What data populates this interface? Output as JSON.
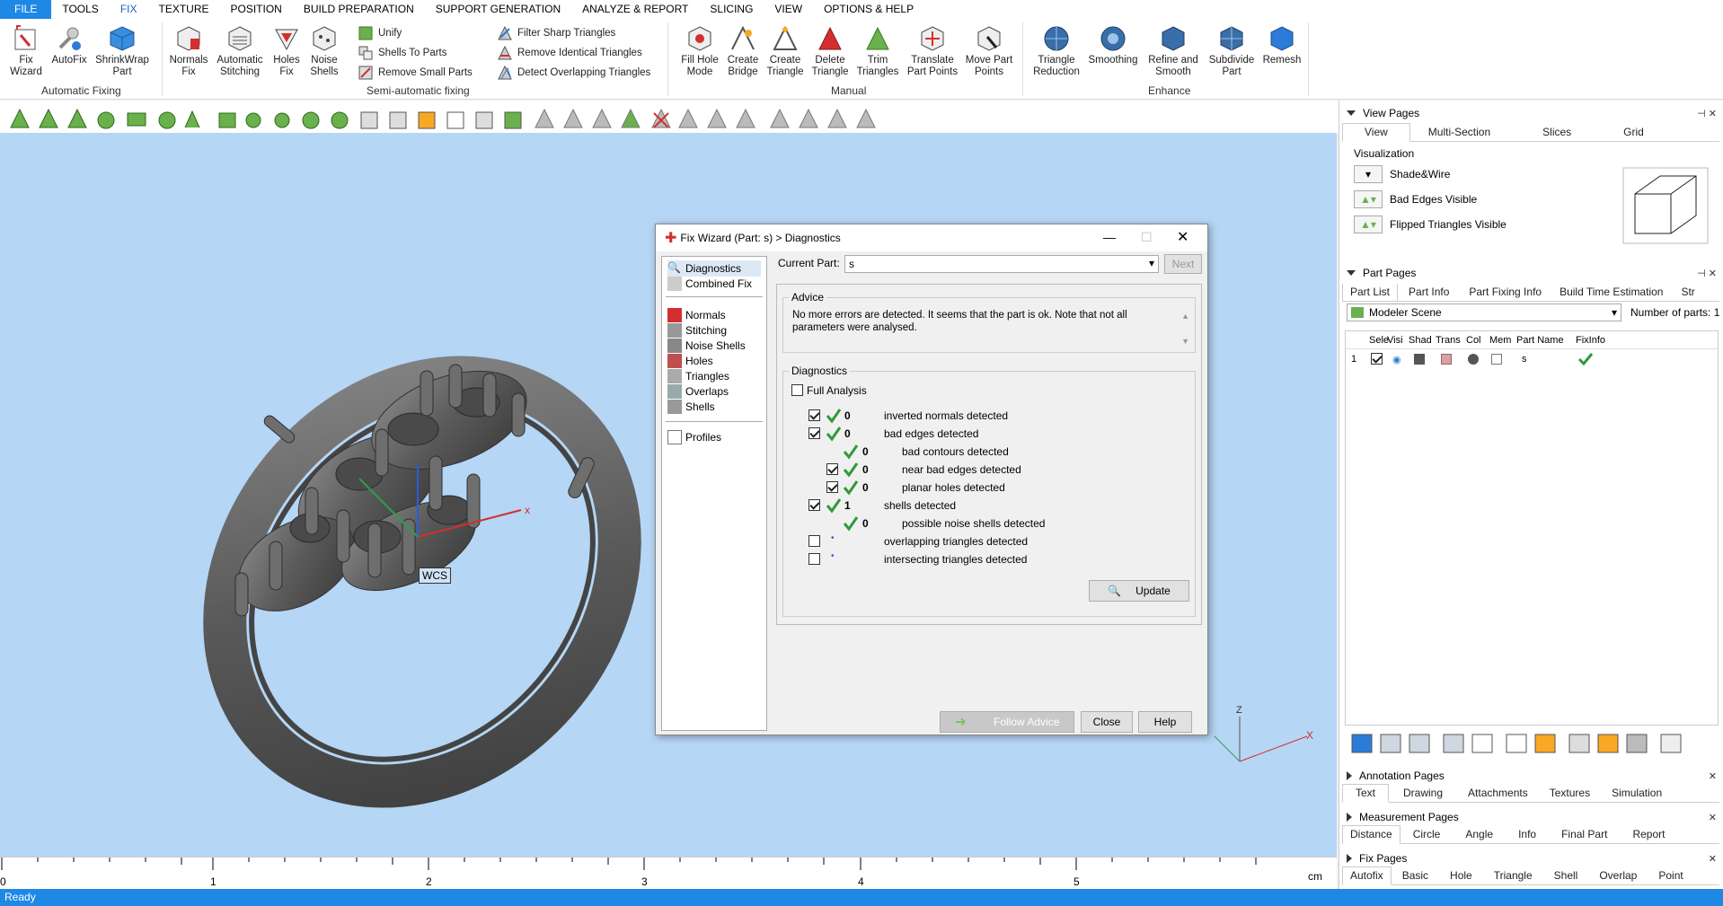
{
  "menu": [
    "FILE",
    "TOOLS",
    "FIX",
    "TEXTURE",
    "POSITION",
    "BUILD PREPARATION",
    "SUPPORT GENERATION",
    "ANALYZE & REPORT",
    "SLICING",
    "VIEW",
    "OPTIONS & HELP"
  ],
  "ribbon": {
    "auto": [
      "Fix\nWizard",
      "AutoFix",
      "ShrinkWrap\nPart"
    ],
    "auto_group": "Automatic Fixing",
    "semi_big": [
      "Normals\nFix",
      "Automatic\nStitching",
      "Holes\nFix",
      "Noise\nShells"
    ],
    "semi_small": [
      "Unify",
      "Shells To Parts",
      "Remove Small Parts"
    ],
    "semi_group": "Semi-automatic fixing",
    "filters": [
      "Filter Sharp Triangles",
      "Remove Identical Triangles",
      "Detect Overlapping Triangles"
    ],
    "manual": [
      "Fill Hole\nMode",
      "Create\nBridge",
      "Create\nTriangle",
      "Delete\nTriangle",
      "Trim\nTriangles",
      "Translate\nPart Points",
      "Move Part\nPoints"
    ],
    "manual_group": "Manual",
    "enhance": [
      "Triangle\nReduction",
      "Smoothing",
      "Refine and\nSmooth",
      "Subdivide\nPart",
      "Remesh"
    ],
    "enhance_group": "Enhance"
  },
  "viewport": {
    "wcs": "WCS",
    "x": "x",
    "z": "Z",
    "x2": "X"
  },
  "ruler": {
    "labels": [
      "0",
      "1",
      "2",
      "3",
      "4",
      "5"
    ],
    "unit": "cm"
  },
  "status": "Ready",
  "dialog": {
    "title": "Fix Wizard (Part: s) > Diagnostics",
    "nav_top": [
      "Diagnostics",
      "Combined Fix"
    ],
    "nav_mid": [
      "Normals",
      "Stitching",
      "Noise Shells",
      "Holes",
      "Triangles",
      "Overlaps",
      "Shells"
    ],
    "nav_bottom": [
      "Profiles"
    ],
    "current_part_label": "Current Part:",
    "current_part_value": "s",
    "next": "Next",
    "advice_label": "Advice",
    "advice_text": "No more errors are detected. It seems that the part is ok. Note that not all parameters were analysed.",
    "diag_label": "Diagnostics",
    "full_analysis": "Full Analysis",
    "rows": [
      {
        "count": "0",
        "text": "inverted normals detected"
      },
      {
        "count": "0",
        "text": "bad edges detected"
      },
      {
        "count": "0",
        "text": "bad contours detected"
      },
      {
        "count": "0",
        "text": "near bad edges detected"
      },
      {
        "count": "0",
        "text": "planar holes detected"
      },
      {
        "count": "1",
        "text": "shells detected"
      },
      {
        "count": "0",
        "text": "possible noise shells detected"
      },
      {
        "count": "",
        "text": "overlapping triangles detected"
      },
      {
        "count": "",
        "text": "intersecting triangles detected"
      }
    ],
    "update": "Update",
    "follow": "Follow Advice",
    "close": "Close",
    "help": "Help"
  },
  "right": {
    "view_pages": "View Pages",
    "view_tabs": [
      "View",
      "Multi-Section",
      "Slices",
      "Grid"
    ],
    "visualization": "Visualization",
    "vis_items": [
      "Shade&Wire",
      "Bad Edges Visible",
      "Flipped Triangles Visible"
    ],
    "part_pages": "Part Pages",
    "part_tabs": [
      "Part List",
      "Part Info",
      "Part Fixing Info",
      "Build Time Estimation",
      "Str"
    ],
    "scene": "Modeler Scene",
    "num_parts_label": "Number of parts:",
    "num_parts": "1",
    "columns": [
      "Sele",
      "Visi",
      "Shad",
      "Trans",
      "Col",
      "Mem",
      "Part Name",
      "FixInfo"
    ],
    "row_index": "1",
    "row_name": "s",
    "annotation_pages": "Annotation Pages",
    "annotation_tabs": [
      "Text",
      "Drawing",
      "Attachments",
      "Textures",
      "Simulation"
    ],
    "measurement_pages": "Measurement Pages",
    "measurement_tabs": [
      "Distance",
      "Circle",
      "Angle",
      "Info",
      "Final Part",
      "Report"
    ],
    "fix_pages": "Fix Pages",
    "fix_tabs": [
      "Autofix",
      "Basic",
      "Hole",
      "Triangle",
      "Shell",
      "Overlap",
      "Point"
    ]
  },
  "colors": {
    "accent": "#1e88e5",
    "check": "#2e9b3a",
    "viewport": "#b5d6f5"
  }
}
